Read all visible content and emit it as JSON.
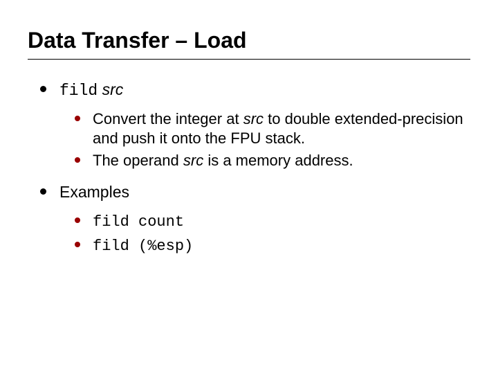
{
  "title": "Data Transfer – Load",
  "items": [
    {
      "label_code": "fild",
      "label_ital": " src",
      "sub": [
        {
          "pre": "Convert the integer at ",
          "ital": "src",
          "post": " to double extended-precision and push it onto the FPU stack."
        },
        {
          "pre": "The operand ",
          "ital": "src",
          "post": " is a memory address."
        }
      ]
    },
    {
      "label_plain": "Examples",
      "sub_code": [
        "fild count",
        "fild (%esp)"
      ]
    }
  ]
}
